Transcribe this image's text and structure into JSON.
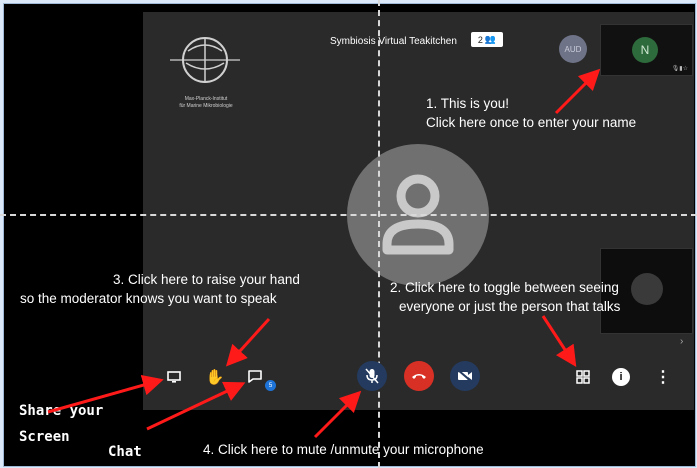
{
  "meeting": {
    "title": "Symbiosis Virtual Teakitchen",
    "participant_count": "2",
    "logo_text_line1": "Max-Planck-Institut",
    "logo_text_line2": "für Marine Mikrobiologie"
  },
  "participants": {
    "audio_avatar": "AUD",
    "self_initial": "N"
  },
  "toolbar": {
    "chat_unread": "5"
  },
  "annotations": {
    "self_line1": "1. This is you!",
    "self_line2": "Click here once to enter your name",
    "view_line1": "2. Click here to toggle between seeing",
    "view_line2": "everyone or just the person that talks",
    "hand_line1": "3. Click here to raise your hand",
    "hand_line2": "so the moderator knows you want to speak",
    "mute": "4. Click here to mute /unmute your microphone",
    "share_line1": "Share your",
    "share_line2": "Screen",
    "chat": "Chat"
  },
  "colors": {
    "arrow": "#ff1a1a",
    "hangup": "#d93025",
    "control_blue": "#243a5e"
  }
}
